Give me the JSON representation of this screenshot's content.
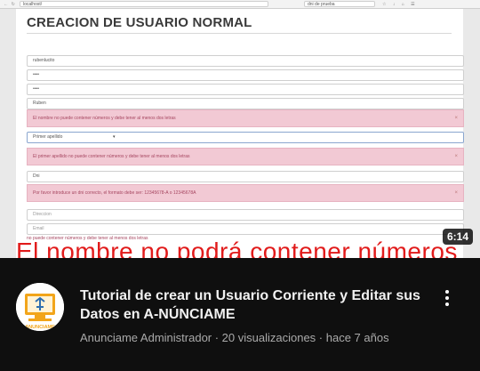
{
  "browser": {
    "nav_glyphs": "← ↻",
    "url": "localhost/",
    "search": "dni de prueba",
    "tools": "☆ ↓ ⌂ ☰"
  },
  "form": {
    "title": "CREACION DE USUARIO NORMAL",
    "fields": [
      {
        "value": "rubenlucito"
      },
      {
        "value": "••••"
      },
      {
        "value": "••••"
      },
      {
        "value": "Ruben"
      }
    ],
    "alert_1": "El nombre no puede contener números y debe tener al menos dos letras",
    "select": {
      "value": "Primer apellido",
      "arrow": "▾"
    },
    "alert_2": "El primer apellido no puede contener números y debe tener al menos dos letras",
    "dni": {
      "value": "Dni"
    },
    "alert_3": "Por favor introduce un dni correcto, el formato debe ser: 12345678-A o 12345678A",
    "direccion": {
      "placeholder": "Direccion"
    },
    "email": {
      "placeholder": "Email"
    },
    "alert_close": "×"
  },
  "overlay": {
    "duration": "6:14",
    "caption": "El nombre no podrá contener números y",
    "caption_sub": "no puede contener números y debe tener al menos dos letras"
  },
  "video": {
    "title": "Tutorial de crear un Usuario Corriente y Editar sus Datos en A-NÚNCIAME",
    "meta": "Anunciame Administrador · 20 visualizaciones · hace 7 años",
    "channel_logo_text": "ANUNCIAME"
  },
  "colors": {
    "alert_bg": "#f2c9d4",
    "alert_text": "#a64660",
    "caption": "#e11b1b",
    "logo_orange": "#f2a51a",
    "logo_blue": "#2f6fb0"
  },
  "icons": {
    "menu": "more-vert-icon",
    "close": "close-icon",
    "select": "chevron-down-icon"
  }
}
